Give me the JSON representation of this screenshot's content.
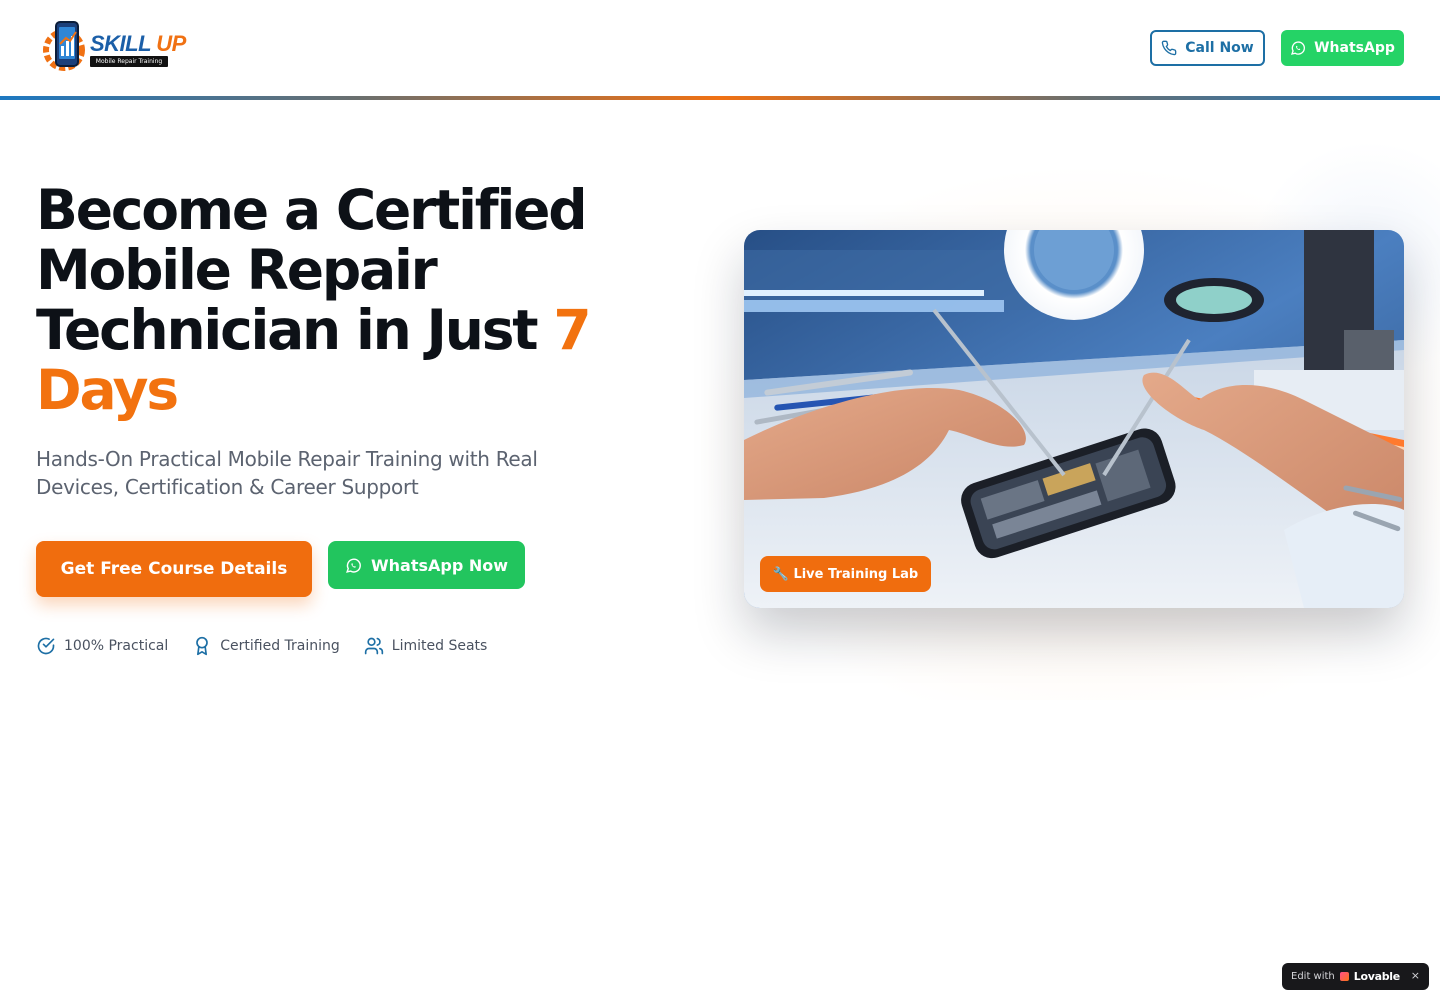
{
  "header": {
    "logo_word_1": "SKILL",
    "logo_word_2": " UP",
    "logo_tagline": "Mobile Repair Training",
    "call_label": "Call Now",
    "whatsapp_label": "WhatsApp"
  },
  "hero": {
    "headline_main": "Become a Certified Mobile Repair Technician in Just ",
    "headline_accent": "7 Days",
    "subline": "Hands-On Practical Mobile Repair Training with Real Devices, Certification & Career Support",
    "cta_primary": "Get Free Course Details",
    "cta_whatsapp": "WhatsApp Now",
    "features": [
      {
        "icon": "check-circle-icon",
        "label": "100% Practical"
      },
      {
        "icon": "award-icon",
        "label": "Certified Training"
      },
      {
        "icon": "users-icon",
        "label": "Limited Seats"
      }
    ],
    "image_badge": "🔧 Live Training Lab"
  },
  "lovable": {
    "prefix": "Edit with",
    "brand": "Lovable",
    "close": "×"
  },
  "colors": {
    "accent_orange": "#f06d0e",
    "brand_blue": "#1d6fa5",
    "whatsapp_green": "#22c55e"
  }
}
